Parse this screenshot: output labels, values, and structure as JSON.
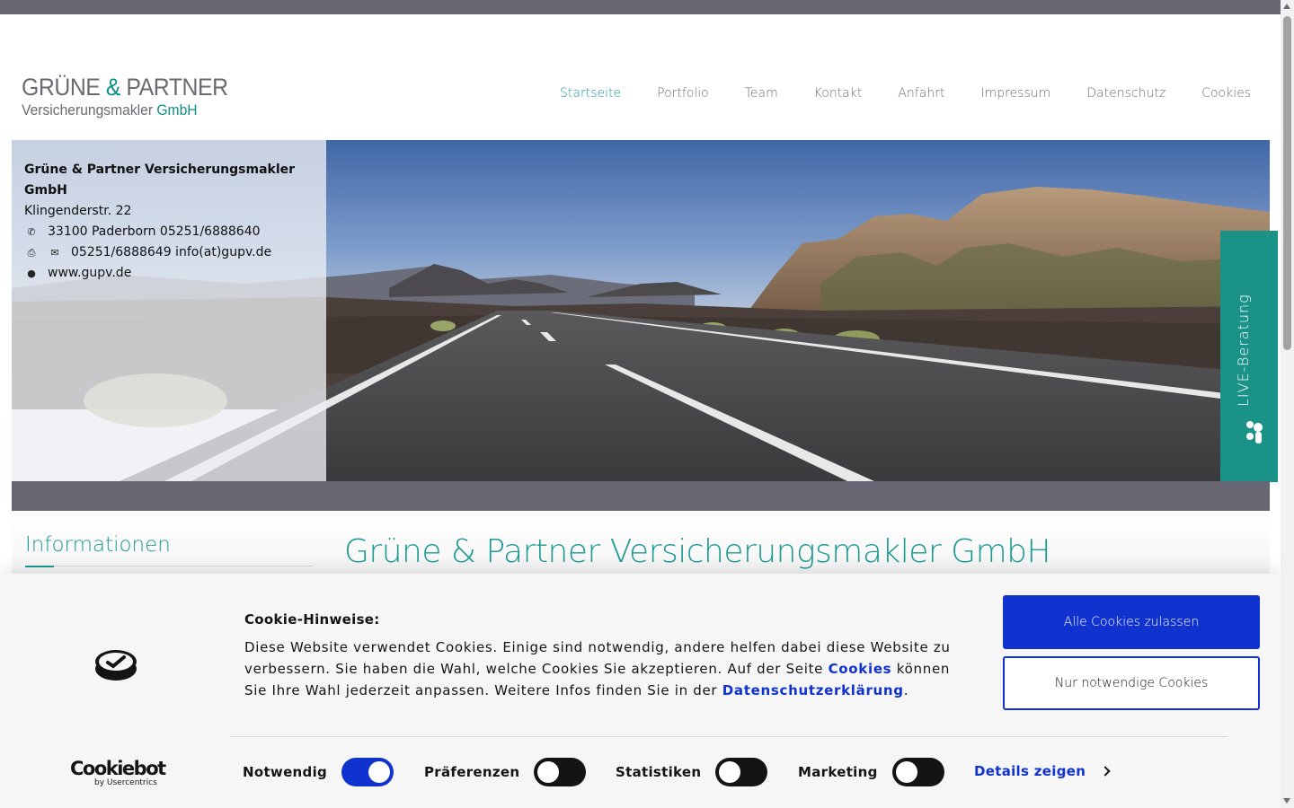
{
  "logo": {
    "line1_a": "GRÜNE ",
    "line1_amp": "&",
    "line1_b": " PARTNER",
    "line2_a": "Versicherungsmakler ",
    "line2_b": "GmbH"
  },
  "nav": {
    "items": [
      "Startseite",
      "Portfolio",
      "Team",
      "Kontakt",
      "Anfahrt",
      "Impressum",
      "Datenschutz",
      "Cookies"
    ],
    "active": "Startseite"
  },
  "address": {
    "company": "Grüne & Partner Versicherungsmakler GmbH",
    "street": "Klingenderstr. 22",
    "city_phone": "33100 Paderborn 05251/6888640",
    "fax_mail": "05251/6888649 info(at)gupv.de",
    "web": "www.gupv.de"
  },
  "live_tab": {
    "label": "LIVE-Beratung"
  },
  "sidebar": {
    "title": "Informationen"
  },
  "main": {
    "title": "Grüne & Partner Versicherungsmakler GmbH"
  },
  "cookie": {
    "title": "Cookie-Hinweise:",
    "text_1": "Diese Website verwendet Cookies. Einige sind notwendig, andere helfen dabei diese Website zu verbessern. Sie haben die Wahl, welche Cookies Sie akzeptieren. Auf der Seite ",
    "link_1": "Cookies",
    "text_2": " können Sie Ihre Wahl jederzeit anpassen. Weitere Infos finden Sie in der ",
    "link_2": "Datenschutzerklärung",
    "text_3": ".",
    "btn_all": "Alle Cookies zulassen",
    "btn_necessary": "Nur notwendige Cookies",
    "toggles": [
      {
        "label": "Notwendig",
        "on": true
      },
      {
        "label": "Präferenzen",
        "on": false
      },
      {
        "label": "Statistiken",
        "on": false
      },
      {
        "label": "Marketing",
        "on": false
      }
    ],
    "details": "Details zeigen",
    "brand_name": "Cookiebot",
    "brand_sub": "by Usercentrics"
  },
  "colors": {
    "accent": "#1d9a92",
    "cookie_blue": "#1032cf",
    "bar_grey": "#666772"
  }
}
